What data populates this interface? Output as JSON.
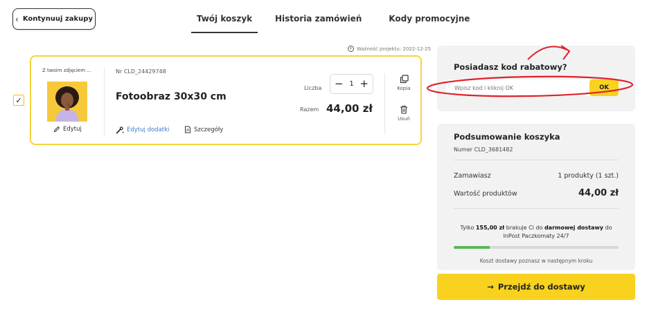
{
  "nav": {
    "back_label": "Kontynuuj zakupy",
    "tabs": [
      {
        "label": "Twój koszyk",
        "active": true
      },
      {
        "label": "Historia zamówień",
        "active": false
      },
      {
        "label": "Kody promocyjne",
        "active": false
      }
    ]
  },
  "cart": {
    "validity": "Ważność projektu: 2022-12-25",
    "item": {
      "checked": true,
      "checkmark": "✓",
      "image_caption": "Z twoim zdjęciem ...",
      "edit_label": "Edytuj",
      "number": "Nr CLD_24429748",
      "name": "Fotoobraz 30x30 cm",
      "edit_addons_label": "Edytuj dodatki",
      "details_label": "Szczegóły",
      "quantity_label": "Liczba",
      "quantity": "1",
      "minus": "−",
      "plus": "+",
      "total_label": "Razem",
      "total_value": "44,00 zł",
      "copy_label": "Kopia",
      "delete_label": "Usuń"
    }
  },
  "promo": {
    "title": "Posiadasz kod rabatowy?",
    "placeholder": "Wpisz kod i kliknij OK",
    "button_label": "OK"
  },
  "summary": {
    "title": "Podsumowanie koszyka",
    "number": "Numer CLD_3681482",
    "rows": [
      {
        "label": "Zamawiasz",
        "value": "1 produkty (1 szt.)"
      },
      {
        "label": "Wartość produktów",
        "value": "44,00 zł"
      }
    ],
    "free_shipping": {
      "prefix": "Tylko ",
      "amount": "155,00 zł",
      "middle": " brakuje Ci do ",
      "bold": "darmowej dostawy",
      "suffix": " do",
      "line2": "InPost Paczkomaty 24/7",
      "progress_fraction": 0.22
    },
    "shipping_note": "Koszt dostawy poznasz w następnym kroku"
  },
  "checkout": {
    "arrow": "→",
    "label": "Przejdź do dostawy"
  },
  "colors": {
    "accent_yellow": "#f8d21f",
    "card_border": "#f7d43a",
    "link_blue": "#3d7ec7",
    "progress_green": "#5ab65a",
    "annotation_red": "#e0202a"
  }
}
